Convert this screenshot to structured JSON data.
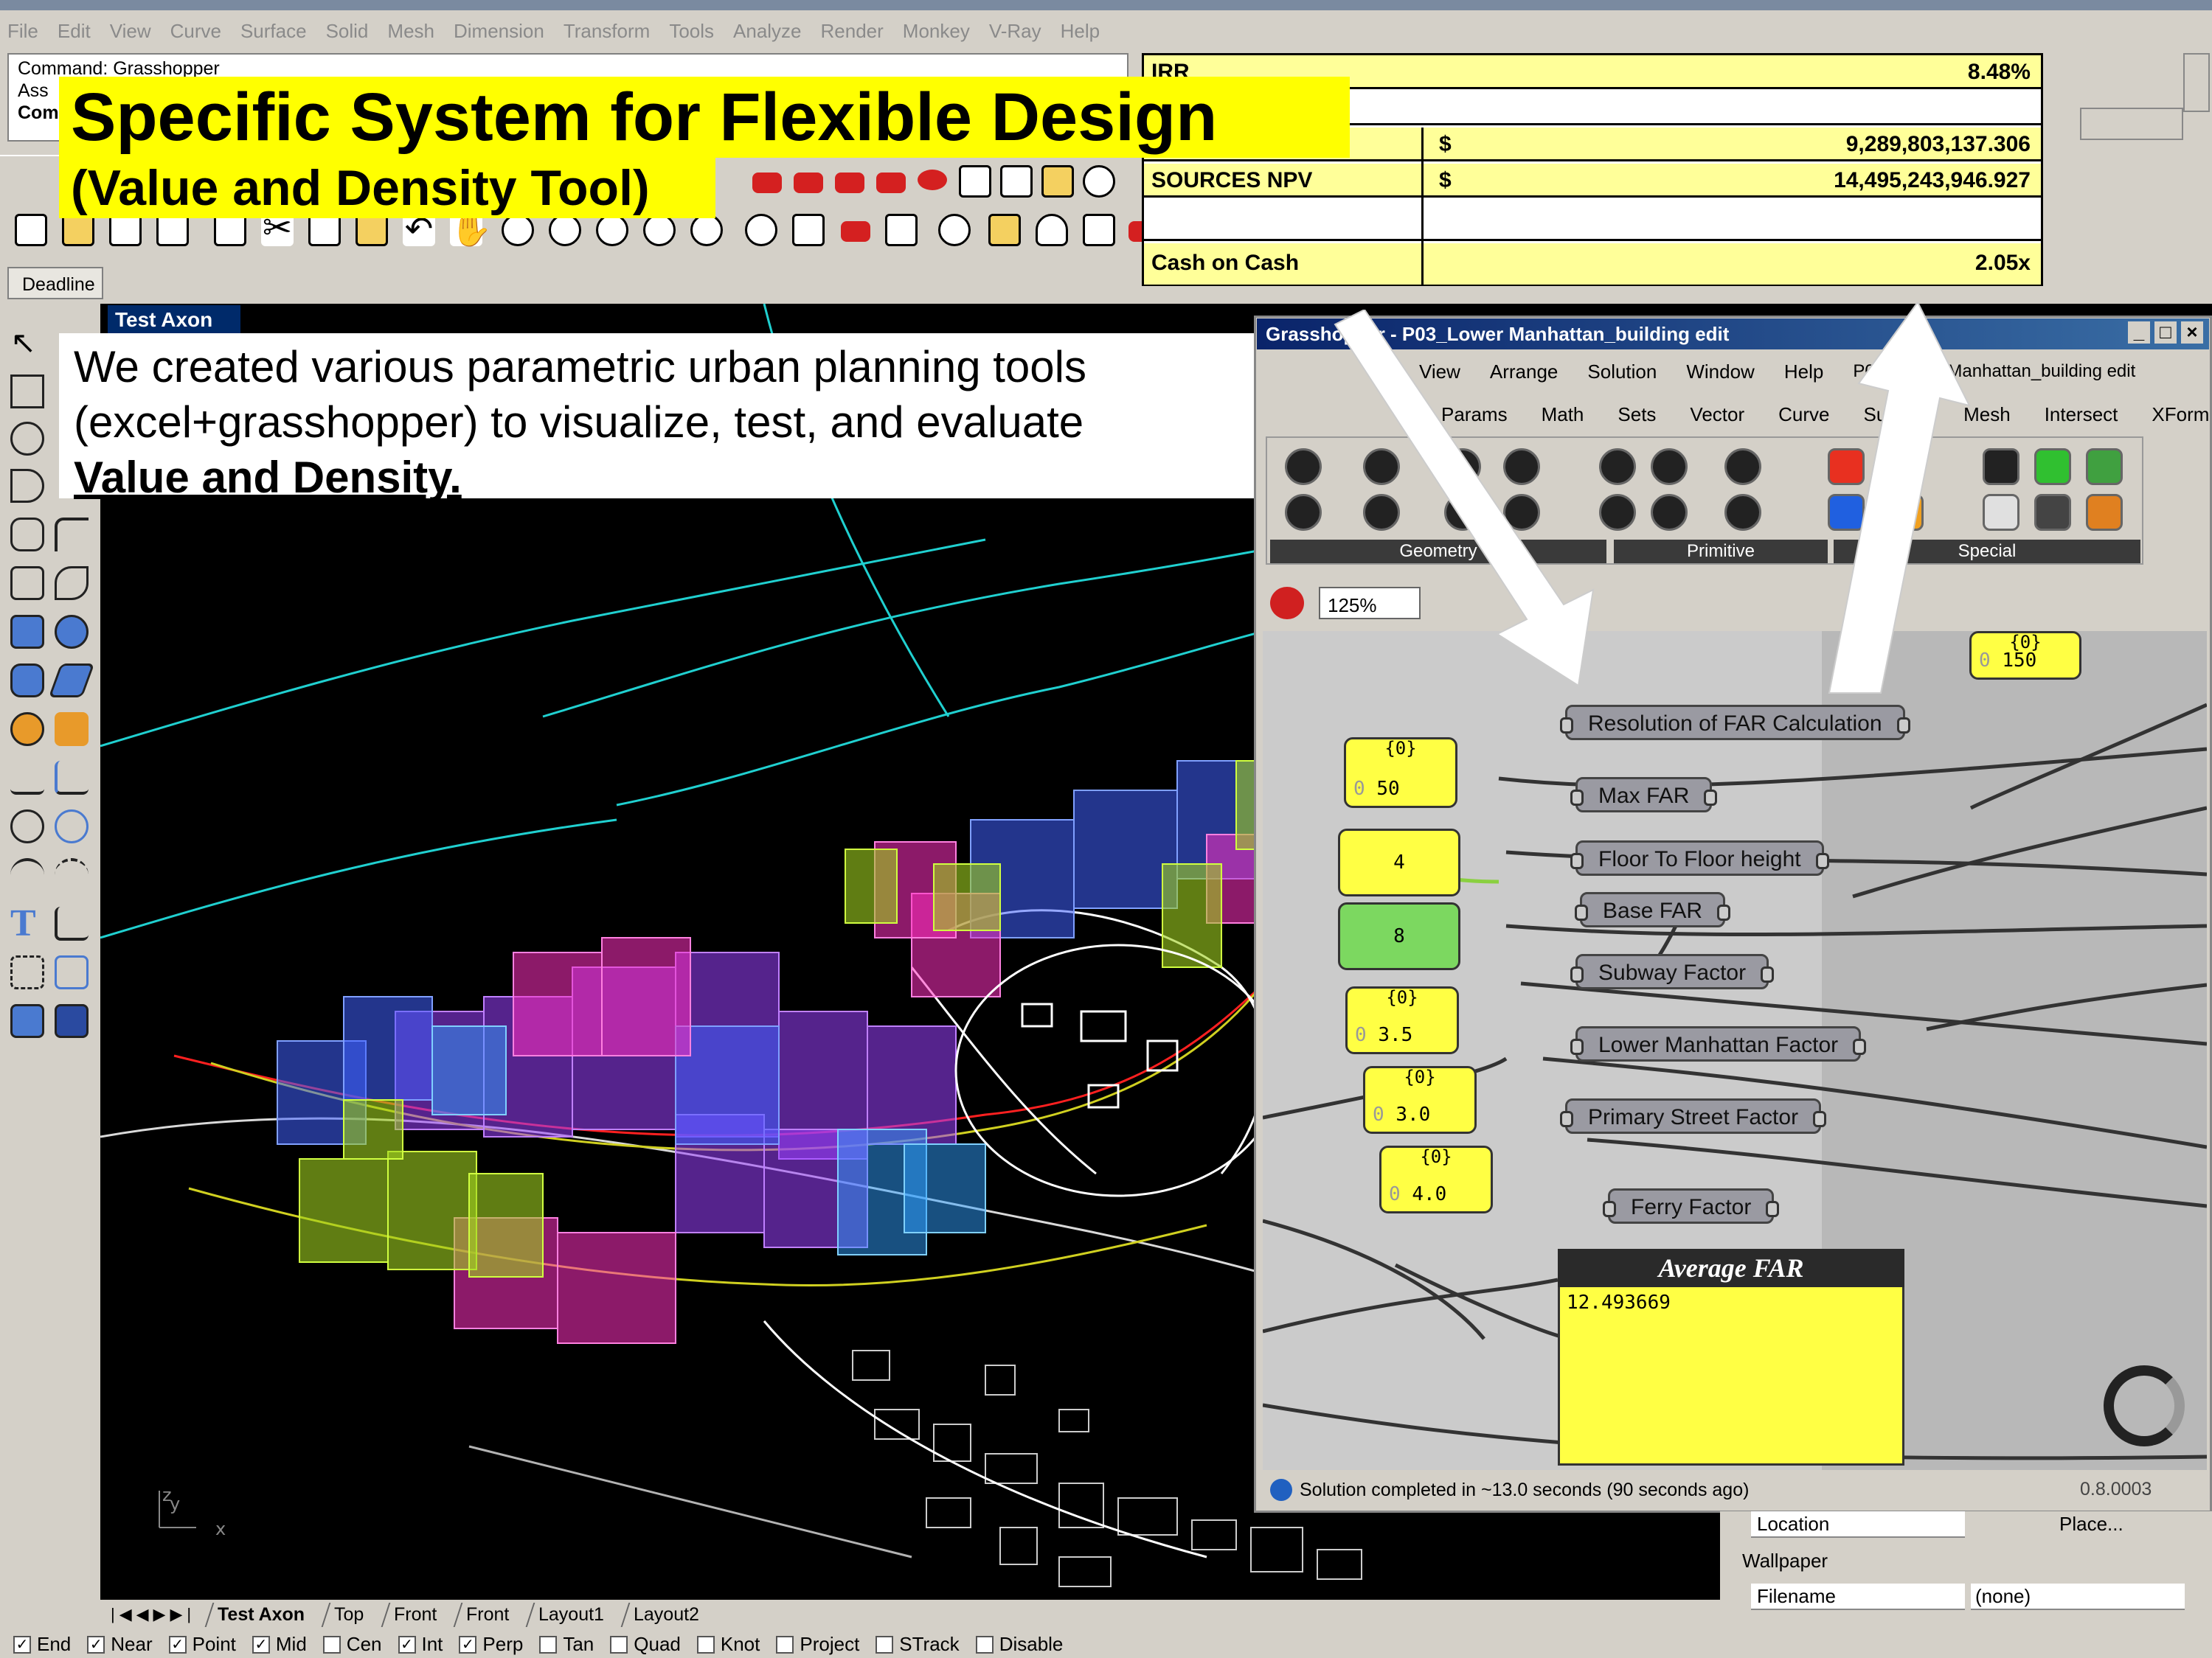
{
  "menu": [
    "File",
    "Edit",
    "View",
    "Curve",
    "Surface",
    "Solid",
    "Mesh",
    "Dimension",
    "Transform",
    "Tools",
    "Analyze",
    "Render",
    "Monkey",
    "V-Ray",
    "Help"
  ],
  "command": {
    "line1": "Command: Grasshopper",
    "line2": "Ass",
    "line3": "Com"
  },
  "slide": {
    "title": "Specific System for Flexible Design",
    "subtitle": "(Value and Density Tool)",
    "desc_prefix": "We created various parametric urban planning tools (excel+grasshopper) to visualize, test, and evaluate",
    "desc_bold": "Value and Density."
  },
  "excel": {
    "rows": [
      {
        "label": "IRR",
        "cur": "",
        "value": "8.48%"
      },
      {
        "label": "",
        "cur": "",
        "value": ""
      },
      {
        "label": "",
        "cur": "$",
        "value": "9,289,803,137.306"
      },
      {
        "label": "SOURCES NPV",
        "cur": "$",
        "value": "14,495,243,946.927"
      },
      {
        "label": "",
        "cur": "",
        "value": ""
      },
      {
        "label": "Cash on Cash",
        "cur": "",
        "value": "2.05x"
      }
    ]
  },
  "deadline_tab": "Deadline",
  "viewport": {
    "label": "Test Axon",
    "axis_y": "y",
    "axis_z": "z",
    "axis_x": "x"
  },
  "viewport_tabs": [
    "Test Axon",
    "Top",
    "Front",
    "Front",
    "Layout1",
    "Layout2"
  ],
  "osnaps": [
    {
      "label": "End",
      "checked": true
    },
    {
      "label": "Near",
      "checked": true
    },
    {
      "label": "Point",
      "checked": true
    },
    {
      "label": "Mid",
      "checked": true
    },
    {
      "label": "Cen",
      "checked": false
    },
    {
      "label": "Int",
      "checked": true
    },
    {
      "label": "Perp",
      "checked": true
    },
    {
      "label": "Tan",
      "checked": false
    },
    {
      "label": "Quad",
      "checked": false
    },
    {
      "label": "Knot",
      "checked": false
    },
    {
      "label": "Project",
      "checked": false
    },
    {
      "label": "STrack",
      "checked": false
    },
    {
      "label": "Disable",
      "checked": false
    }
  ],
  "gh": {
    "title": "Grasshopper - P03_Lower Manhattan_building edit",
    "menu": [
      "View",
      "Arrange",
      "Solution",
      "Window",
      "Help",
      "P03_Lower Manhattan_building edit"
    ],
    "tabs": [
      "Params",
      "Math",
      "Sets",
      "Vector",
      "Curve",
      "Surface",
      "Mesh",
      "Intersect",
      "XForm"
    ],
    "palette_groups": [
      "Geometry",
      "Primitive",
      "Special"
    ],
    "zoom": "125%",
    "components": [
      "Resolution of FAR Calculation",
      "Max FAR",
      "Floor To Floor height",
      "Base FAR",
      "Subway Factor",
      "Lower Manhattan Factor",
      "Primary Street Factor",
      "Ferry Factor"
    ],
    "inputs": [
      {
        "hdr": "{0}",
        "idx": "0",
        "val": "150"
      },
      {
        "hdr": "{0}",
        "idx": "0",
        "val": "50"
      },
      {
        "hdr": "",
        "idx": "",
        "val": "4"
      },
      {
        "hdr": "",
        "idx": "",
        "val": "8"
      },
      {
        "hdr": "{0}",
        "idx": "0",
        "val": "3.5"
      },
      {
        "hdr": "{0}",
        "idx": "0",
        "val": "3.0"
      },
      {
        "hdr": "{0}",
        "idx": "0",
        "val": "4.0"
      }
    ],
    "panel": {
      "title": "Average FAR",
      "value": "12.493669"
    },
    "status": "Solution completed in ~13.0 seconds (90 seconds ago)",
    "version": "0.8.0003"
  },
  "props": {
    "location_label": "Location",
    "location_btn": "Place...",
    "wallpaper": "Wallpaper",
    "filename_label": "Filename",
    "filename_value": "(none)"
  }
}
